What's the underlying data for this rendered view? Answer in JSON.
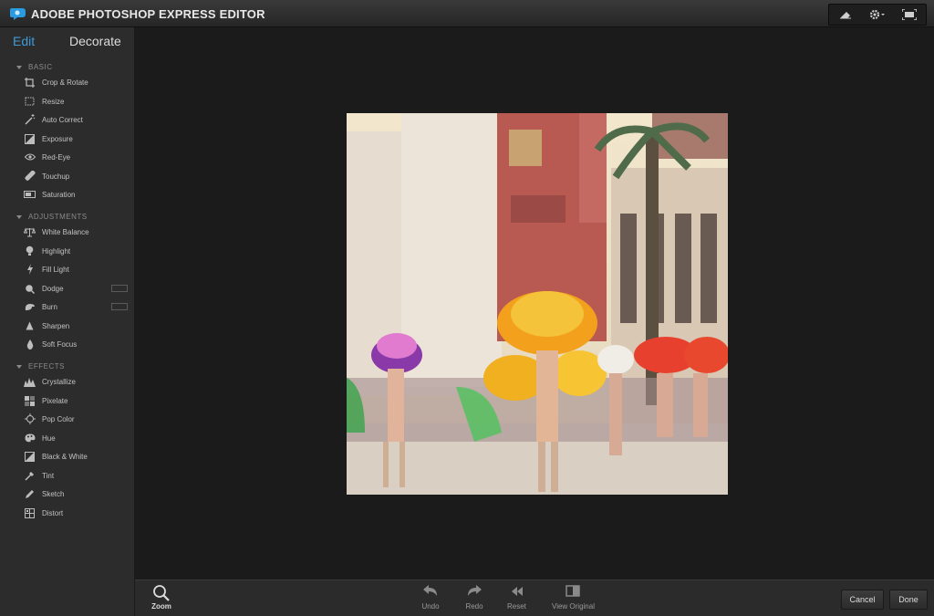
{
  "app": {
    "title": "ADOBE PHOTOSHOP EXPRESS EDITOR"
  },
  "colors": {
    "accent": "#3d9bd8",
    "sidebar": "#2c2c2c",
    "canvas": "#1b1b1b"
  },
  "tabs": {
    "edit": "Edit",
    "decorate": "Decorate"
  },
  "sections": {
    "basic": {
      "header": "BASIC",
      "items": [
        {
          "label": "Crop & Rotate",
          "icon": "crop-icon"
        },
        {
          "label": "Resize",
          "icon": "resize-icon"
        },
        {
          "label": "Auto Correct",
          "icon": "magic-wand-icon"
        },
        {
          "label": "Exposure",
          "icon": "exposure-icon"
        },
        {
          "label": "Red-Eye",
          "icon": "eye-icon"
        },
        {
          "label": "Touchup",
          "icon": "bandage-icon"
        },
        {
          "label": "Saturation",
          "icon": "saturation-icon"
        }
      ]
    },
    "adjustments": {
      "header": "ADJUSTMENTS",
      "items": [
        {
          "label": "White Balance",
          "icon": "scale-icon"
        },
        {
          "label": "Highlight",
          "icon": "bulb-icon"
        },
        {
          "label": "Fill Light",
          "icon": "lightning-icon"
        },
        {
          "label": "Dodge",
          "icon": "dodge-icon"
        },
        {
          "label": "Burn",
          "icon": "burn-icon"
        },
        {
          "label": "Sharpen",
          "icon": "triangle-icon"
        },
        {
          "label": "Soft Focus",
          "icon": "drop-icon"
        }
      ]
    },
    "effects": {
      "header": "EFFECTS",
      "items": [
        {
          "label": "Crystallize",
          "icon": "crystallize-icon"
        },
        {
          "label": "Pixelate",
          "icon": "pixelate-icon"
        },
        {
          "label": "Pop Color",
          "icon": "target-icon"
        },
        {
          "label": "Hue",
          "icon": "palette-icon"
        },
        {
          "label": "Black & White",
          "icon": "bw-icon"
        },
        {
          "label": "Tint",
          "icon": "dropper-icon"
        },
        {
          "label": "Sketch",
          "icon": "pencil-icon"
        },
        {
          "label": "Distort",
          "icon": "distort-icon"
        }
      ]
    }
  },
  "bottombar": {
    "zoom": "Zoom",
    "undo": "Undo",
    "redo": "Redo",
    "reset": "Reset",
    "view_original": "View Original",
    "cancel": "Cancel",
    "done": "Done"
  }
}
